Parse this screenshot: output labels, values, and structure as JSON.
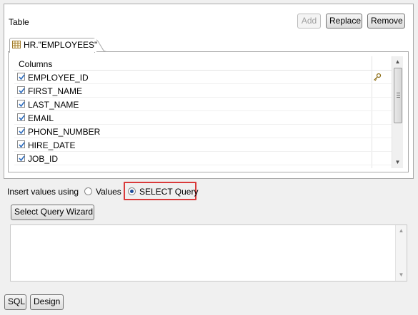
{
  "table_section": {
    "label": "Table",
    "buttons": {
      "add": "Add",
      "replace": "Replace",
      "remove": "Remove"
    },
    "tab_label": "HR.\"EMPLOYEES\"",
    "columns_header": "Columns",
    "columns": [
      {
        "name": "EMPLOYEE_ID",
        "checked": true,
        "key": true
      },
      {
        "name": "FIRST_NAME",
        "checked": true,
        "key": false
      },
      {
        "name": "LAST_NAME",
        "checked": true,
        "key": false
      },
      {
        "name": "EMAIL",
        "checked": true,
        "key": false
      },
      {
        "name": "PHONE_NUMBER",
        "checked": true,
        "key": false
      },
      {
        "name": "HIRE_DATE",
        "checked": true,
        "key": false
      },
      {
        "name": "JOB_ID",
        "checked": true,
        "key": false
      }
    ]
  },
  "insert": {
    "label": "Insert values using",
    "option_values": "Values",
    "option_select": "SELECT Query",
    "selected": "SELECT Query"
  },
  "wizard_button": "Select Query Wizard",
  "query_text": "",
  "bottom_tabs": {
    "sql": "SQL",
    "design": "Design"
  },
  "colors": {
    "highlight": "#d93a3a",
    "radio_dot": "#1f4e9c",
    "check": "#2a6bbf"
  }
}
